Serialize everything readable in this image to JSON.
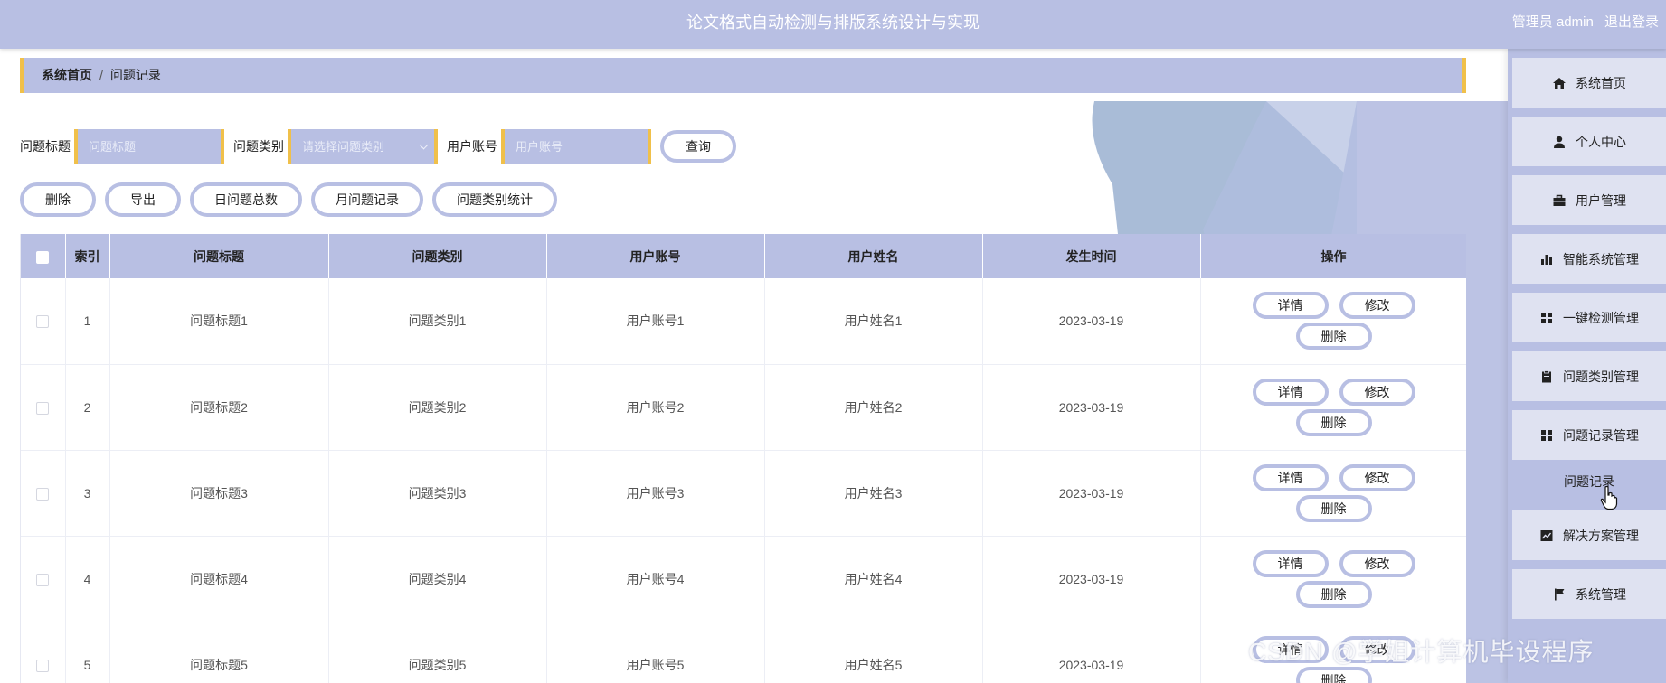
{
  "header": {
    "title": "论文格式自动检测与排版系统设计与实现",
    "role": "管理员 admin",
    "logout": "退出登录"
  },
  "breadcrumb": {
    "home": "系统首页",
    "separator": "/",
    "current": "问题记录"
  },
  "search": {
    "title_label": "问题标题",
    "title_placeholder": "问题标题",
    "category_label": "问题类别",
    "category_placeholder": "请选择问题类别",
    "account_label": "用户账号",
    "account_placeholder": "用户账号",
    "query_button": "查询"
  },
  "actions": [
    "删除",
    "导出",
    "日问题总数",
    "月问题记录",
    "问题类别统计"
  ],
  "table": {
    "columns": [
      "索引",
      "问题标题",
      "问题类别",
      "用户账号",
      "用户姓名",
      "发生时间",
      "操作"
    ],
    "rows": [
      {
        "index": "1",
        "title": "问题标题1",
        "category": "问题类别1",
        "account": "用户账号1",
        "name": "用户姓名1",
        "time": "2023-03-19"
      },
      {
        "index": "2",
        "title": "问题标题2",
        "category": "问题类别2",
        "account": "用户账号2",
        "name": "用户姓名2",
        "time": "2023-03-19"
      },
      {
        "index": "3",
        "title": "问题标题3",
        "category": "问题类别3",
        "account": "用户账号3",
        "name": "用户姓名3",
        "time": "2023-03-19"
      },
      {
        "index": "4",
        "title": "问题标题4",
        "category": "问题类别4",
        "account": "用户账号4",
        "name": "用户姓名4",
        "time": "2023-03-19"
      },
      {
        "index": "5",
        "title": "问题标题5",
        "category": "问题类别5",
        "account": "用户账号5",
        "name": "用户姓名5",
        "time": "2023-03-19"
      }
    ],
    "op_labels": {
      "detail": "详情",
      "edit": "修改",
      "delete": "删除"
    }
  },
  "sidebar": {
    "items": [
      {
        "label": "系统首页",
        "icon": "home-icon"
      },
      {
        "label": "个人中心",
        "icon": "user-icon"
      },
      {
        "label": "用户管理",
        "icon": "briefcase-icon"
      },
      {
        "label": "智能系统管理",
        "icon": "bar-chart-icon"
      },
      {
        "label": "一键检测管理",
        "icon": "grid-icon"
      },
      {
        "label": "问题类别管理",
        "icon": "clipboard-icon"
      },
      {
        "label": "问题记录管理",
        "icon": "grid-icon"
      },
      {
        "label": "解决方案管理",
        "icon": "line-chart-icon"
      },
      {
        "label": "系统管理",
        "icon": "flag-icon"
      }
    ],
    "active_sub": "问题记录"
  },
  "watermark": "CSDN @学姐计算机毕设程序",
  "colors": {
    "accent": "#b8bfe3",
    "accent_light": "#dfe2f1",
    "border_highlight": "#f0c04a",
    "deco": "#9fb4d4"
  }
}
